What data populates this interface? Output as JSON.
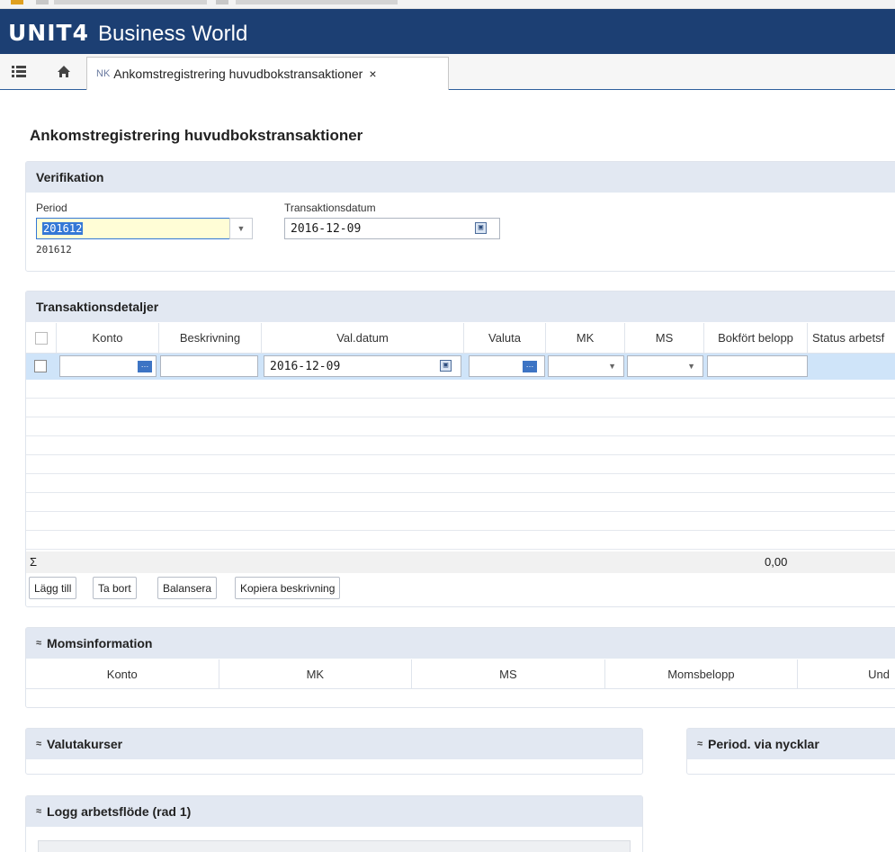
{
  "app": {
    "logo": "UNIT4",
    "name": "Business World"
  },
  "tabs": [
    {
      "prefix": "NK",
      "label": "Ankomstregistrering huvudbokstransaktioner",
      "close": "×"
    }
  ],
  "page": {
    "title": "Ankomstregistrering huvudbokstransaktioner"
  },
  "verification": {
    "title": "Verifikation",
    "period_label": "Period",
    "period_value": "201612",
    "period_hint": "201612",
    "date_label": "Transaktionsdatum",
    "date_value": "2016-12-09"
  },
  "details": {
    "title": "Transaktionsdetaljer",
    "columns": [
      "Konto",
      "Beskrivning",
      "Val.datum",
      "Valuta",
      "MK",
      "MS",
      "Bokfört belopp",
      "Status arbetsf"
    ],
    "row": {
      "val_datum": "2016-12-09"
    },
    "sum_symbol": "Σ",
    "sum_value": "0,00",
    "buttons": {
      "add": "Lägg till",
      "remove": "Ta bort",
      "balance": "Balansera",
      "copy": "Kopiera beskrivning"
    }
  },
  "vat": {
    "title": "Momsinformation",
    "chevron": "≈",
    "columns": [
      "Konto",
      "MK",
      "MS",
      "Momsbelopp",
      "Und"
    ]
  },
  "currency": {
    "title": "Valutakurser",
    "chevron": "≈"
  },
  "period_keys": {
    "title": "Period. via nycklar",
    "chevron": "≈"
  },
  "workflow_log": {
    "title": "Logg arbetsflöde (rad 1)",
    "chevron": "≈"
  },
  "colors": {
    "brand_bar": "#1c3f73",
    "panel_header": "#e2e8f2",
    "selected_row": "#cfe4f9",
    "period_highlight": "#fffdd6",
    "selection_blue": "#3478d6"
  }
}
